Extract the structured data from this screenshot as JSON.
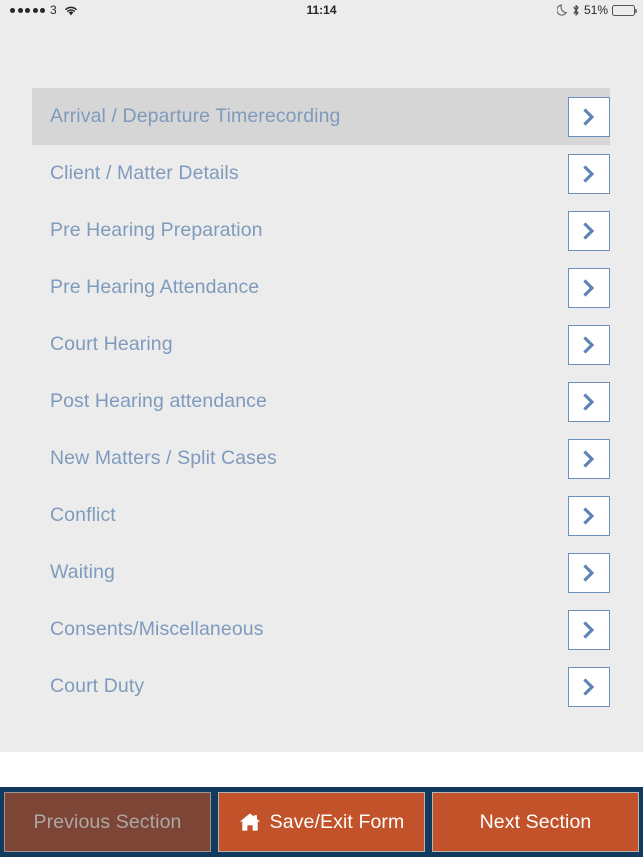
{
  "statusbar": {
    "signal_dots": 5,
    "carrier": "3",
    "wifi_icon": "wifi-icon",
    "time": "11:14",
    "do_not_disturb_icon": "moon-icon",
    "bluetooth_icon": "bluetooth-icon",
    "battery_percent": "51%",
    "battery_level": 51
  },
  "colors": {
    "panel_background": "#ececec",
    "row_selected_background": "#d6d6d6",
    "row_label_text": "#7e9bbd",
    "chevron_border": "#6c8fbb",
    "chevron_glyph": "#5d82b4",
    "toolbar_background": "#123a5e",
    "button_active": "#c1522a",
    "button_disabled": "#7c4535",
    "button_disabled_text": "#ada8a5"
  },
  "sections": {
    "items": [
      {
        "label": "Arrival / Departure Timerecording",
        "selected": true,
        "chevron_icon": "chevron-right-icon"
      },
      {
        "label": "Client / Matter Details",
        "selected": false,
        "chevron_icon": "chevron-right-icon"
      },
      {
        "label": "Pre Hearing Preparation",
        "selected": false,
        "chevron_icon": "chevron-right-icon"
      },
      {
        "label": "Pre Hearing Attendance",
        "selected": false,
        "chevron_icon": "chevron-right-icon"
      },
      {
        "label": "Court Hearing",
        "selected": false,
        "chevron_icon": "chevron-right-icon"
      },
      {
        "label": "Post Hearing attendance",
        "selected": false,
        "chevron_icon": "chevron-right-icon"
      },
      {
        "label": "New Matters / Split Cases",
        "selected": false,
        "chevron_icon": "chevron-right-icon"
      },
      {
        "label": "Conflict",
        "selected": false,
        "chevron_icon": "chevron-right-icon"
      },
      {
        "label": "Waiting",
        "selected": false,
        "chevron_icon": "chevron-right-icon"
      },
      {
        "label": "Consents/Miscellaneous",
        "selected": false,
        "chevron_icon": "chevron-right-icon"
      },
      {
        "label": "Court Duty",
        "selected": false,
        "chevron_icon": "chevron-right-icon"
      }
    ]
  },
  "toolbar": {
    "previous_label": "Previous Section",
    "previous_disabled": true,
    "save_exit_label": "Save/Exit Form",
    "save_exit_icon": "home-icon",
    "next_label": "Next Section",
    "next_disabled": false
  }
}
